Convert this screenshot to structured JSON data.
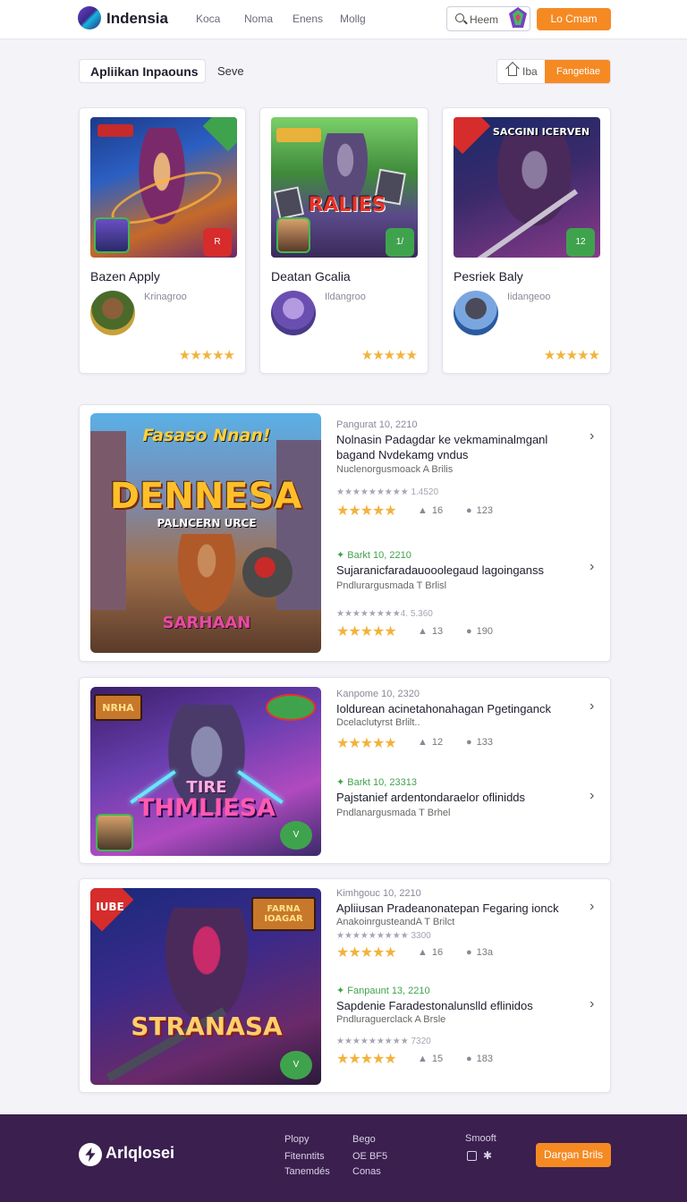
{
  "header": {
    "logo": "Indensia",
    "nav": [
      "Koca",
      "Noma",
      "Enens",
      "Mollg"
    ],
    "search_label": "Heem",
    "cta_label": "Lo Cmam"
  },
  "toolbar": {
    "tab_label": "Apliikan Inpaouns",
    "save_label": "Seve",
    "home_label": "Iba",
    "fav_label": "Fangetiae"
  },
  "top_cards": [
    {
      "title": "Bazen Apply",
      "sub": "Krinagroo",
      "stars": "★★★★★",
      "badge": "R"
    },
    {
      "title": "Deatan Gcalia",
      "sub": "Ildangroo",
      "stars": "★★★★★",
      "badge": "1/"
    },
    {
      "title": "Pesriek Baly",
      "sub": "Iidangeoo",
      "stars": "★★★★★",
      "badge": "12"
    }
  ],
  "top_card_overlays": [
    "RALIES",
    "TIRE",
    "SACGINI ICERVEN"
  ],
  "list_cards": [
    {
      "art_title": "DENNESA",
      "art_top": "Fasaso Nnan!",
      "art_sub": "PALNCERN URCE",
      "art_bottom": "SARHAAN",
      "entries": [
        {
          "meta": "Pangurat  10, 2210",
          "title": "Nolnasin Padagdar ke vekmaminalmganl bagand Nvdekamg vndus",
          "sub": "Nuclenorgusmoack A Brilis",
          "rating": "★★★★★★★★★ 1.4520",
          "stars": "★★★★★",
          "likes": "16",
          "views": "123"
        },
        {
          "meta": "Barkt  10, 2210",
          "title": "Sujaranicfaradauooolegaud lagoinganss",
          "sub": "Pndlurargusmada T Brlisl",
          "rating": "★★★★★★★★4. 5.360",
          "stars": "★★★★★",
          "likes": "13",
          "views": "190"
        }
      ]
    },
    {
      "art_title": "THMLIESA",
      "art_top": "TIRE",
      "art_badge": "NRHA",
      "entries": [
        {
          "meta": "Kanpome  10, 2320",
          "title": "Ioldurean acinetahonahagan Pgetinganck",
          "sub": "Dcelaclutyrst Brlilt..",
          "stars": "★★★★★",
          "likes": "12",
          "views": "133"
        },
        {
          "meta": "Barkt  10, 23313",
          "title": "Pajstanief ardentondaraelor oflinidds",
          "sub": "Pndlanargusmada T Brhel",
          "stars": "",
          "likes": "",
          "views": ""
        }
      ]
    },
    {
      "art_title": "STRANASA",
      "art_top": "FARNA IOAGAR",
      "art_badge": "IUBE",
      "entries": [
        {
          "meta": "Kimhgouc  10, 2210",
          "title": "Apliiusan Pradeanonatepan Fegaring ionck",
          "sub": "AnakoinrgusteandA T Brilct",
          "rating": "★★★★★★★★★ 3300",
          "stars": "★★★★★",
          "likes": "16",
          "views": "13a"
        },
        {
          "meta": "Fanpaunt  13, 2210",
          "title": "Sapdenie Faradestonalunslld eflinidos",
          "sub": "Pndluraguerclack A Brsle",
          "rating": "★★★★★★★★★ 7320",
          "stars": "★★★★★",
          "likes": "15",
          "views": "183"
        }
      ]
    }
  ],
  "footer": {
    "logo": "Arlqlosei",
    "col1": [
      "Plopy",
      "Fitenntits",
      "Tanemdés"
    ],
    "col2": [
      "Bego",
      "OE BF5",
      "Conas"
    ],
    "col3_title": "Smooft",
    "cta_label": "Dargan Brils"
  },
  "colors": {
    "accent": "#f58a23",
    "footer_bg": "#3a1f4f",
    "star": "#f2b33d"
  }
}
